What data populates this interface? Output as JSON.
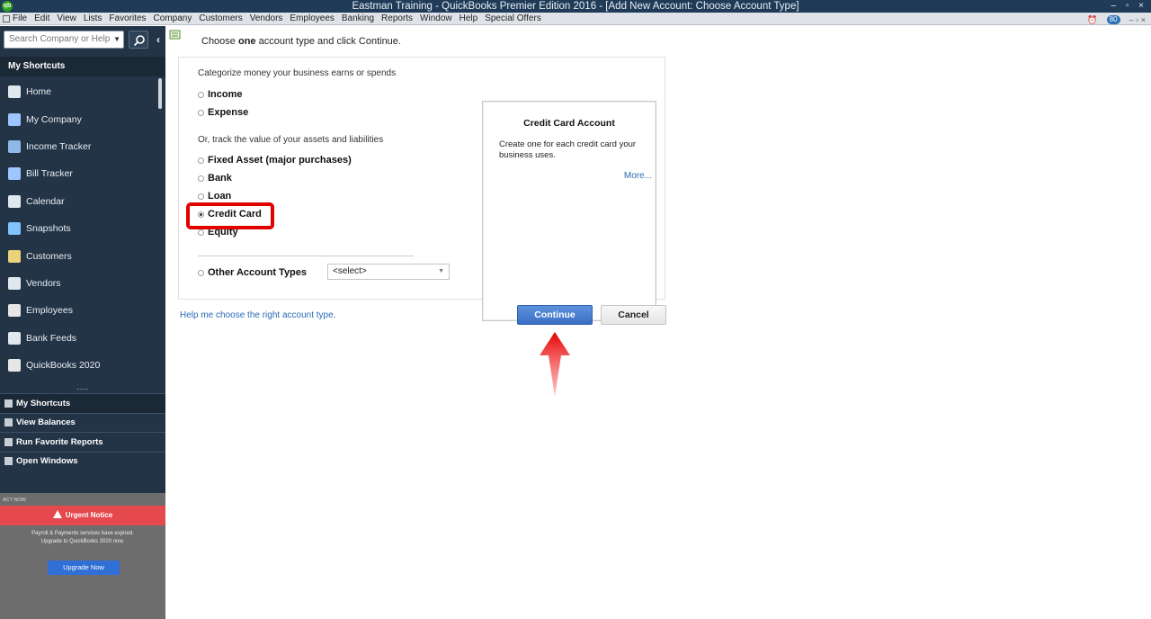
{
  "window": {
    "title": "Eastman Training  - QuickBooks Premier Edition 2016 - [Add New Account: Choose Account Type]",
    "logo_text": "qb",
    "controls": "– ▫ ×"
  },
  "menubar": {
    "items": [
      "File",
      "Edit",
      "View",
      "Lists",
      "Favorites",
      "Company",
      "Customers",
      "Vendors",
      "Employees",
      "Banking",
      "Reports",
      "Window",
      "Help",
      "Special Offers"
    ],
    "badge": "80",
    "right_controls": "– ▫ ×"
  },
  "sidebar": {
    "search_placeholder": "Search Company or Help",
    "shortcuts_header": "My Shortcuts",
    "items": [
      {
        "label": "Home",
        "icon": "home-icon"
      },
      {
        "label": "My Company",
        "icon": "company-icon"
      },
      {
        "label": "Income Tracker",
        "icon": "income-tracker-icon"
      },
      {
        "label": "Bill Tracker",
        "icon": "bill-tracker-icon"
      },
      {
        "label": "Calendar",
        "icon": "calendar-icon"
      },
      {
        "label": "Snapshots",
        "icon": "snapshots-icon"
      },
      {
        "label": "Customers",
        "icon": "customers-icon"
      },
      {
        "label": "Vendors",
        "icon": "vendors-icon"
      },
      {
        "label": "Employees",
        "icon": "employees-icon"
      },
      {
        "label": "Bank Feeds",
        "icon": "bank-icon"
      },
      {
        "label": "QuickBooks 2020",
        "icon": "upgrade-arrow-icon"
      }
    ],
    "bottom_nav": [
      {
        "label": "My Shortcuts",
        "active": true
      },
      {
        "label": "View Balances",
        "active": false
      },
      {
        "label": "Run Favorite Reports",
        "active": false
      },
      {
        "label": "Open Windows",
        "active": false
      }
    ],
    "act_now": {
      "label": "ACT NOW",
      "urgent_title": "Urgent Notice",
      "urgent_text": "Payroll & Payments services have expired. Upgrade to QuickBooks 2020 now.",
      "upgrade_button": "Upgrade Now"
    }
  },
  "dialog": {
    "instruction_prefix": "Choose ",
    "instruction_bold": "one",
    "instruction_suffix": " account type and click Continue.",
    "categorize_label": "Categorize money your business earns or spends",
    "track_label": "Or, track the value of your assets and liabilities",
    "options": {
      "income": "Income",
      "expense": "Expense",
      "fixed_asset": "Fixed Asset (major purchases)",
      "bank": "Bank",
      "loan": "Loan",
      "credit_card": "Credit Card",
      "equity": "Equity",
      "other": "Other Account Types"
    },
    "selected": "credit_card",
    "other_select_value": "<select>",
    "description": {
      "title": "Credit Card Account",
      "text": "Create one for each credit card your business uses.",
      "more": "More..."
    },
    "help_link": "Help me choose the right account type.",
    "continue_button": "Continue",
    "cancel_button": "Cancel"
  },
  "colors": {
    "sidebar_bg": "#243447",
    "highlight_red": "#e00000",
    "continue_blue": "#3a6ec4",
    "link_blue": "#2a6bb5",
    "urgent_red": "#e5484d"
  }
}
